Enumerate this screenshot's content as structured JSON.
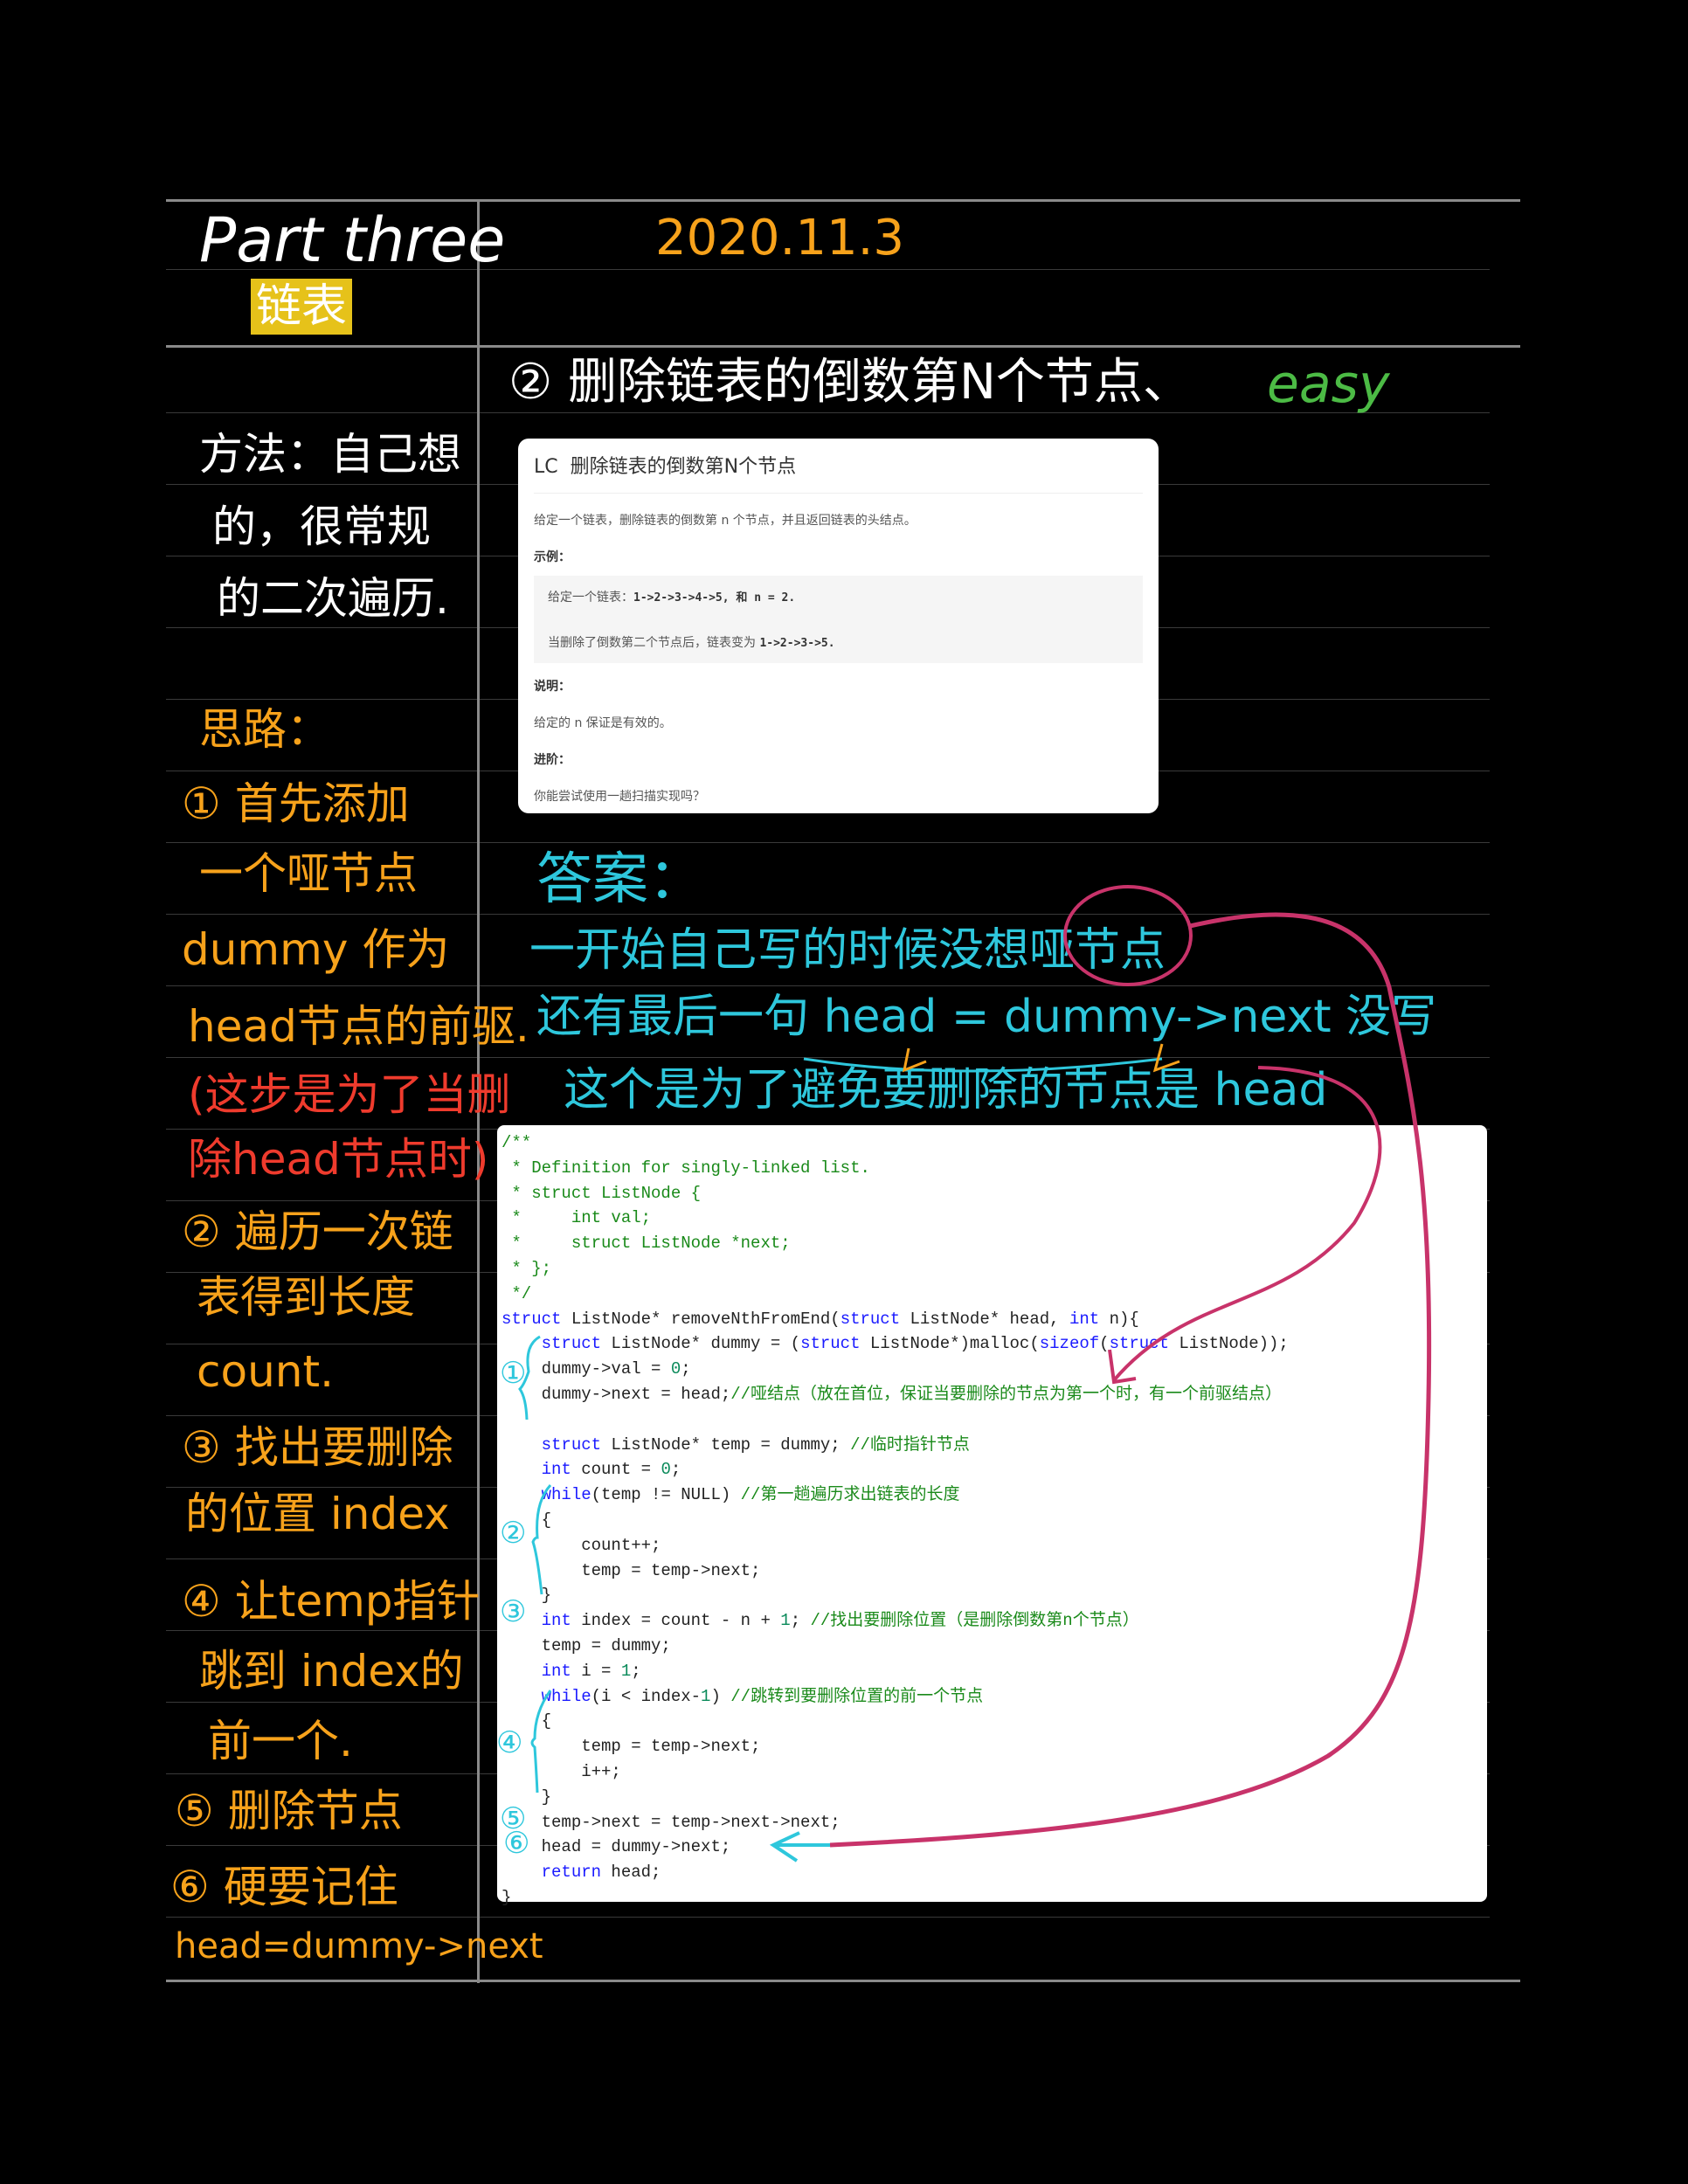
{
  "header": {
    "title": "Part three",
    "subtitle": "链表",
    "date": "2020.11.3"
  },
  "problem_heading": {
    "text": "② 删除链表的倒数第N个节点、",
    "difficulty": "easy"
  },
  "method_notes": [
    "方法：自己想",
    "的，很常规",
    "的二次遍历."
  ],
  "approach": {
    "title": "思路：",
    "lines": [
      {
        "text": "① 首先添加",
        "color": "orange"
      },
      {
        "text": "一个哑节点",
        "color": "orange"
      },
      {
        "text": "dummy 作为",
        "color": "orange"
      },
      {
        "text": "head节点的前驱.",
        "color": "orange"
      },
      {
        "text": "(这步是为了当删",
        "color": "red"
      },
      {
        "text": "除head节点时)",
        "color": "red"
      },
      {
        "text": "② 遍历一次链",
        "color": "orange"
      },
      {
        "text": "表得到长度",
        "color": "orange"
      },
      {
        "text": "count.",
        "color": "orange"
      },
      {
        "text": "③ 找出要删除",
        "color": "orange"
      },
      {
        "text": "的位置 index",
        "color": "orange"
      },
      {
        "text": "④ 让temp指针",
        "color": "orange"
      },
      {
        "text": "跳到 index的",
        "color": "orange"
      },
      {
        "text": "前一个.",
        "color": "orange"
      },
      {
        "text": "⑤ 删除节点",
        "color": "orange"
      },
      {
        "text": "⑥ 硬要记住",
        "color": "orange"
      },
      {
        "text": "head=dummy->next",
        "color": "orange"
      }
    ]
  },
  "leetcode_card": {
    "badge": "LC",
    "title": "删除链表的倒数第N个节点",
    "description": "给定一个链表，删除链表的倒数第 n 个节点，并且返回链表的头结点。",
    "example_label": "示例：",
    "example_line1_text": "给定一个链表：",
    "example_line1_code": "1->2->3->4->5, 和 n = 2.",
    "example_line2_text": "当删除了倒数第二个节点后，链表变为",
    "example_line2_code": "1->2->3->5.",
    "note_label": "说明：",
    "note": "给定的 n 保证是有效的。",
    "advanced_label": "进阶：",
    "advanced": "你能尝试使用一趟扫描实现吗？"
  },
  "answer": {
    "title": "答案：",
    "lines": [
      "一开始自己写的时候没想哑节点",
      "还有最后一句 head = dummy->next 没写",
      "这个是为了避免要删除的节点是 head"
    ]
  },
  "step_markers": [
    "①",
    "②",
    "③",
    "④",
    "⑤",
    "⑥"
  ],
  "code_lines": [
    [
      [
        "/**",
        "cm"
      ]
    ],
    [
      [
        " * Definition for singly-linked list.",
        "cm"
      ]
    ],
    [
      [
        " * struct ListNode {",
        "cm"
      ]
    ],
    [
      [
        " *     int val;",
        "cm"
      ]
    ],
    [
      [
        " *     struct ListNode *next;",
        "cm"
      ]
    ],
    [
      [
        " * };",
        "cm"
      ]
    ],
    [
      [
        " */",
        "cm"
      ]
    ],
    [
      [
        "struct",
        "kw"
      ],
      [
        " ListNode* removeNthFromEnd(",
        ""
      ],
      [
        "struct",
        "kw"
      ],
      [
        " ListNode* head, ",
        ""
      ],
      [
        "int",
        "kw"
      ],
      [
        " n){",
        ""
      ]
    ],
    [
      [
        "    ",
        ""
      ],
      [
        "struct",
        "kw"
      ],
      [
        " ListNode* dummy = (",
        ""
      ],
      [
        "struct",
        "kw"
      ],
      [
        " ListNode*)malloc(",
        ""
      ],
      [
        "sizeof",
        "kw"
      ],
      [
        "(",
        ""
      ],
      [
        "struct",
        "kw"
      ],
      [
        " ListNode));",
        ""
      ]
    ],
    [
      [
        "    dummy->val = ",
        ""
      ],
      [
        "0",
        "num"
      ],
      [
        ";",
        ""
      ]
    ],
    [
      [
        "    dummy->next = head;",
        ""
      ],
      [
        "//哑结点（放在首位，保证当要删除的节点为第一个时，有一个前驱结点）",
        "cm"
      ]
    ],
    [
      [
        "",
        ""
      ]
    ],
    [
      [
        "    ",
        ""
      ],
      [
        "struct",
        "kw"
      ],
      [
        " ListNode* temp = dummy; ",
        ""
      ],
      [
        "//临时指针节点",
        "cm"
      ]
    ],
    [
      [
        "    ",
        ""
      ],
      [
        "int",
        "kw"
      ],
      [
        " count = ",
        ""
      ],
      [
        "0",
        "num"
      ],
      [
        ";",
        ""
      ]
    ],
    [
      [
        "    ",
        ""
      ],
      [
        "while",
        "kw"
      ],
      [
        "(temp != NULL) ",
        ""
      ],
      [
        "//第一趟遍历求出链表的长度",
        "cm"
      ]
    ],
    [
      [
        "    {",
        ""
      ]
    ],
    [
      [
        "        count++;",
        ""
      ]
    ],
    [
      [
        "        temp = temp->next;",
        ""
      ]
    ],
    [
      [
        "    }",
        ""
      ]
    ],
    [
      [
        "    ",
        ""
      ],
      [
        "int",
        "kw"
      ],
      [
        " index = count - n + ",
        ""
      ],
      [
        "1",
        "num"
      ],
      [
        "; ",
        ""
      ],
      [
        "//找出要删除位置（是删除倒数第n个节点）",
        "cm"
      ]
    ],
    [
      [
        "    temp = dummy;",
        ""
      ]
    ],
    [
      [
        "    ",
        ""
      ],
      [
        "int",
        "kw"
      ],
      [
        " i = ",
        ""
      ],
      [
        "1",
        "num"
      ],
      [
        ";",
        ""
      ]
    ],
    [
      [
        "    ",
        ""
      ],
      [
        "while",
        "kw"
      ],
      [
        "(i < index-",
        ""
      ],
      [
        "1",
        "num"
      ],
      [
        ") ",
        ""
      ],
      [
        "//跳转到要删除位置的前一个节点",
        "cm"
      ]
    ],
    [
      [
        "    {",
        ""
      ]
    ],
    [
      [
        "        temp = temp->next;",
        ""
      ]
    ],
    [
      [
        "        i++;",
        ""
      ]
    ],
    [
      [
        "    }",
        ""
      ]
    ],
    [
      [
        "    temp->next = temp->next->next;",
        ""
      ]
    ],
    [
      [
        "    head = dummy->next;",
        ""
      ]
    ],
    [
      [
        "    ",
        ""
      ],
      [
        "return",
        "kw"
      ],
      [
        " head;",
        ""
      ]
    ],
    [
      [
        "}",
        ""
      ]
    ]
  ],
  "colors": {
    "orange": "#f7a21b",
    "cyan": "#2ec7dc",
    "green": "#4cbb45",
    "red": "#ef3b2d",
    "magenta": "#c8336a",
    "highlight": "#e6c21a"
  }
}
